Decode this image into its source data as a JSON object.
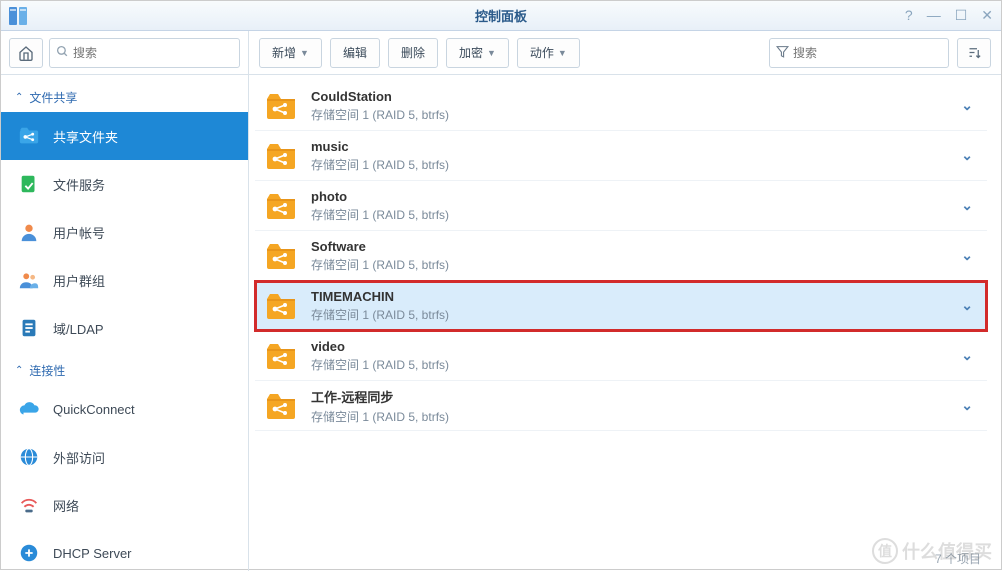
{
  "window": {
    "title": "控制面板"
  },
  "search": {
    "sidebar_placeholder": "搜索",
    "main_placeholder": "搜索"
  },
  "toolbar": {
    "new": "新增",
    "edit": "编辑",
    "delete": "删除",
    "encrypt": "加密",
    "action": "动作"
  },
  "sidebar": {
    "sections": {
      "file_share": "文件共享",
      "connectivity": "连接性"
    },
    "items": {
      "shared_folder": "共享文件夹",
      "file_services": "文件服务",
      "user_account": "用户帐号",
      "user_group": "用户群组",
      "domain_ldap": "域/LDAP",
      "quickconnect": "QuickConnect",
      "external_access": "外部访问",
      "network": "网络",
      "dhcp": "DHCP Server"
    }
  },
  "folders": [
    {
      "name": "CouldStation",
      "sub": "存储空间 1 (RAID 5, btrfs)"
    },
    {
      "name": "music",
      "sub": "存储空间 1 (RAID 5, btrfs)"
    },
    {
      "name": "photo",
      "sub": "存储空间 1 (RAID 5, btrfs)"
    },
    {
      "name": "Software",
      "sub": "存储空间 1 (RAID 5, btrfs)"
    },
    {
      "name": "TIMEMACHIN",
      "sub": "存储空间 1 (RAID 5, btrfs)"
    },
    {
      "name": "video",
      "sub": "存储空间 1 (RAID 5, btrfs)"
    },
    {
      "name": "工作-远程同步",
      "sub": "存储空间 1 (RAID 5, btrfs)"
    }
  ],
  "footer": {
    "count": "7 个项目"
  },
  "watermark": "什么值得买",
  "colors": {
    "accent": "#1e88d6",
    "highlight_border": "#d22b2b",
    "selected_bg": "#d9ecfb",
    "folder_icon": "#f5a623"
  }
}
